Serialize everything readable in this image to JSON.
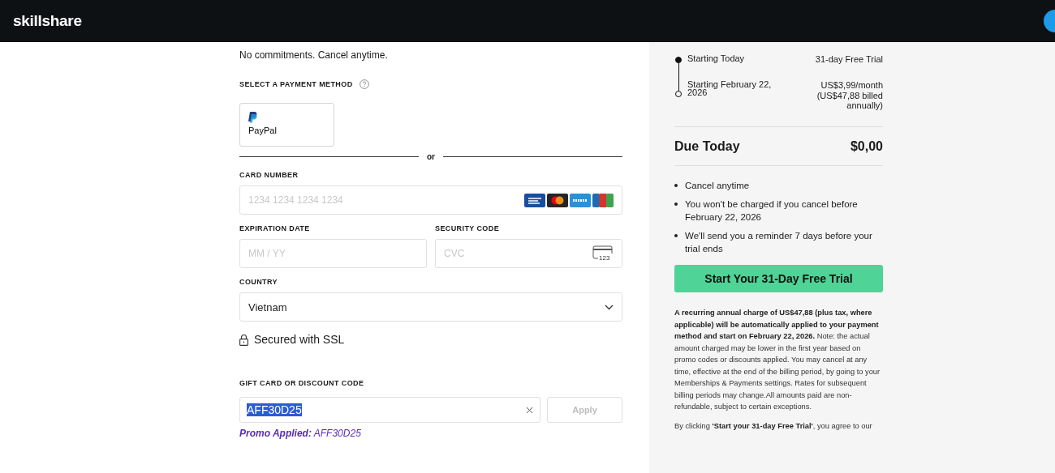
{
  "header": {
    "logo": "skillshare"
  },
  "form": {
    "intro": "No commitments. Cancel anytime.",
    "payment_label": "SELECT A PAYMENT METHOD",
    "paypal": {
      "label": "PayPal"
    },
    "divider": "or",
    "card_number": {
      "label": "CARD NUMBER",
      "placeholder": "1234 1234 1234 1234"
    },
    "expiration": {
      "label": "EXPIRATION DATE",
      "placeholder": "MM / YY"
    },
    "security": {
      "label": "SECURITY CODE",
      "placeholder": "CVC",
      "icon_text": "123"
    },
    "country": {
      "label": "COUNTRY",
      "value": "Vietnam"
    },
    "secure_note": "Secured with SSL",
    "discount": {
      "label": "GIFT CARD OR DISCOUNT CODE",
      "value": "AFF30D25",
      "text_selected": true,
      "apply_button": "Apply",
      "apply_disabled": true
    },
    "promo": "**Promo Applied:** AFF30D25"
  },
  "summary": {
    "timeline": [
      {
        "label": "Starting Today",
        "value": "31-day Free Trial",
        "current": true
      },
      {
        "label": "Starting February 22, 2026",
        "value": "US$3,99/month",
        "note": "(US$47,88 billed annually)",
        "current": false
      }
    ],
    "due": {
      "label": "Due Today",
      "amount": "$0,00"
    },
    "bullets": [
      "Cancel anytime",
      "You won't be charged if you cancel before February 22, 2026",
      "We'll send you a reminder 7 days before your trial ends"
    ],
    "cta": "Start Your 31-Day Free Trial",
    "terms": "**A recurring annual charge of US$47,88 (plus tax, where applicable) will be automatically applied to your payment method and start on February 22, 2026.** Note: the actual amount charged may be lower in the first year based on promo codes or discounts applied. You may cancel at any time, effective at the end of the billing period, by going to your Memberships & Payments settings. Rates for subsequent billing periods may change.All amounts paid are non-refundable, subject to certain exceptions.",
    "consent": "By clicking **'Start your 31-day Free Trial'**, you agree to our"
  }
}
